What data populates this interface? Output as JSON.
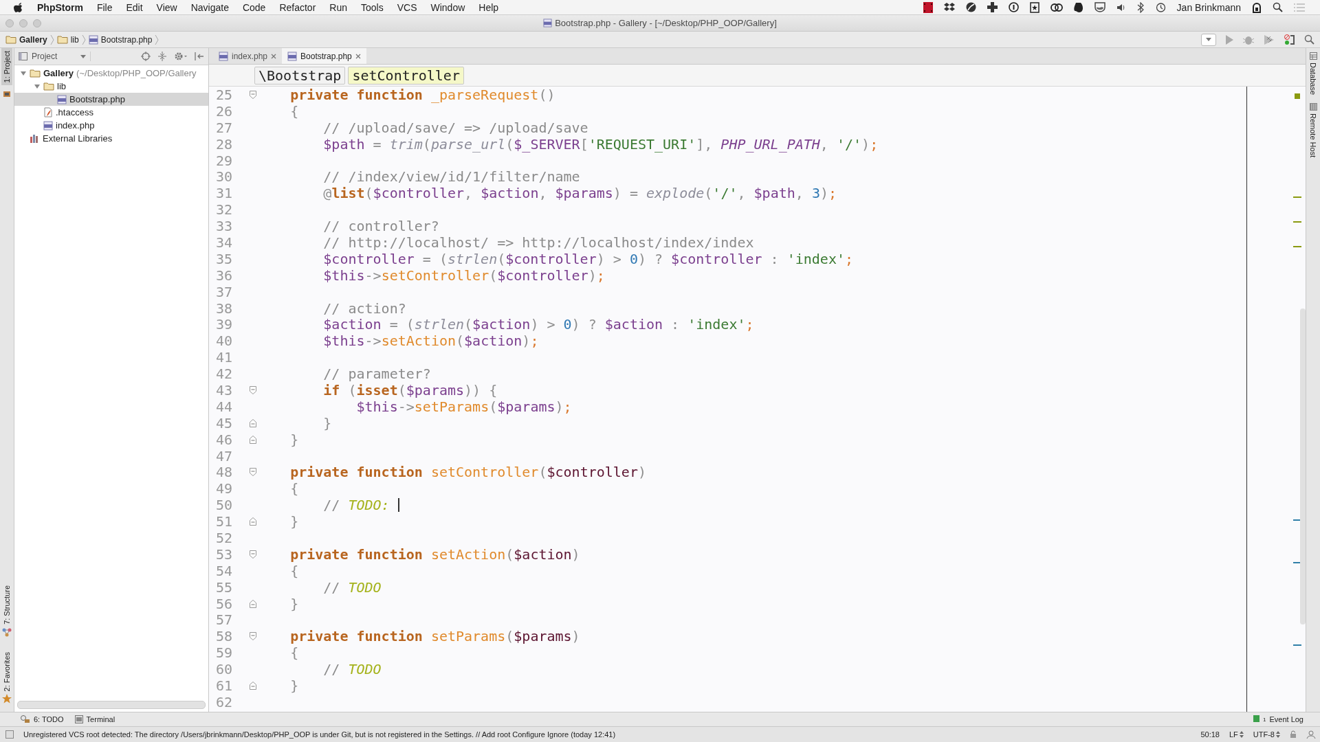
{
  "menu_bar": {
    "app": "PhpStorm",
    "items": [
      "File",
      "Edit",
      "View",
      "Navigate",
      "Code",
      "Refactor",
      "Run",
      "Tools",
      "VCS",
      "Window",
      "Help"
    ],
    "user": "Jan Brinkmann"
  },
  "window": {
    "title": "Bootstrap.php - Gallery - [~/Desktop/PHP_OOP/Gallery]"
  },
  "nav_bar": {
    "breadcrumbs": [
      {
        "label": "Gallery",
        "kind": "folder"
      },
      {
        "label": "lib",
        "kind": "folder"
      },
      {
        "label": "Bootstrap.php",
        "kind": "php"
      }
    ]
  },
  "left_stripe": {
    "top": [
      {
        "label": "1: Project",
        "selected": true
      }
    ],
    "bottom": [
      {
        "label": "7: Structure",
        "kind": "structure"
      },
      {
        "label": "2: Favorites",
        "kind": "favorites"
      }
    ]
  },
  "project_panel": {
    "title": "Project",
    "tree": [
      {
        "label": "Gallery",
        "hint": "(~/Desktop/PHP_OOP/Gallery",
        "kind": "folder",
        "bold": true,
        "expanded": true,
        "selected": false,
        "children": [
          {
            "label": "lib",
            "kind": "folder",
            "bold": false,
            "expanded": true,
            "selected": false,
            "children": [
              {
                "label": "Bootstrap.php",
                "kind": "php",
                "bold": false,
                "selected": true
              }
            ]
          },
          {
            "label": ".htaccess",
            "kind": "htaccess",
            "bold": false,
            "selected": false
          },
          {
            "label": "index.php",
            "kind": "php",
            "bold": false,
            "selected": false
          }
        ]
      },
      {
        "label": "External Libraries",
        "kind": "library",
        "bold": false,
        "selected": false
      }
    ]
  },
  "tabs": [
    {
      "label": "index.php",
      "selected": false
    },
    {
      "label": "Bootstrap.php",
      "selected": true
    }
  ],
  "scope_path": [
    {
      "label": "\\Bootstrap",
      "selected": false
    },
    {
      "label": "setController",
      "selected": true
    }
  ],
  "editor": {
    "lines": [
      {
        "number": "25",
        "kind": "fold_start",
        "tokens": [
          {
            "kind": "kw",
            "text": "    private function "
          },
          {
            "kind": "fn",
            "text": "_parseRequest"
          },
          {
            "kind": "punct",
            "text": "()"
          }
        ]
      },
      {
        "number": "26",
        "tokens": [
          {
            "kind": "punct",
            "text": "    {"
          }
        ]
      },
      {
        "number": "27",
        "tokens": [
          {
            "kind": "comment",
            "text": "        // /upload/save/ => /upload/save"
          }
        ]
      },
      {
        "number": "28",
        "tokens": [
          {
            "kind": "var",
            "text": "        $path"
          },
          {
            "kind": "punct",
            "text": " = "
          },
          {
            "kind": "builtin",
            "text": "trim"
          },
          {
            "kind": "punct",
            "text": "("
          },
          {
            "kind": "builtin",
            "text": "parse_url"
          },
          {
            "kind": "punct",
            "text": "("
          },
          {
            "kind": "var",
            "text": "$_SERVER"
          },
          {
            "kind": "punct",
            "text": "["
          },
          {
            "kind": "str",
            "text": "'REQUEST_URI'"
          },
          {
            "kind": "punct",
            "text": "], "
          },
          {
            "kind": "const",
            "text": "PHP_URL_PATH"
          },
          {
            "kind": "punct",
            "text": ", "
          },
          {
            "kind": "str",
            "text": "'/'"
          },
          {
            "kind": "punct",
            "text": ")"
          },
          {
            "kind": "semi",
            "text": ";"
          }
        ]
      },
      {
        "number": "29"
      },
      {
        "number": "30",
        "tokens": [
          {
            "kind": "comment",
            "text": "        // /index/view/id/1/filter/name"
          }
        ]
      },
      {
        "number": "31",
        "tokens": [
          {
            "kind": "punct",
            "text": "        @"
          },
          {
            "kind": "kw",
            "text": "list"
          },
          {
            "kind": "punct",
            "text": "("
          },
          {
            "kind": "var",
            "text": "$controller"
          },
          {
            "kind": "punct",
            "text": ", "
          },
          {
            "kind": "var",
            "text": "$action"
          },
          {
            "kind": "punct",
            "text": ", "
          },
          {
            "kind": "var",
            "text": "$params"
          },
          {
            "kind": "punct",
            "text": ") = "
          },
          {
            "kind": "builtin",
            "text": "explode"
          },
          {
            "kind": "punct",
            "text": "("
          },
          {
            "kind": "str",
            "text": "'/'"
          },
          {
            "kind": "punct",
            "text": ", "
          },
          {
            "kind": "var",
            "text": "$path"
          },
          {
            "kind": "punct",
            "text": ", "
          },
          {
            "kind": "num",
            "text": "3"
          },
          {
            "kind": "punct",
            "text": ")"
          },
          {
            "kind": "semi",
            "text": ";"
          }
        ]
      },
      {
        "number": "32"
      },
      {
        "number": "33",
        "tokens": [
          {
            "kind": "comment",
            "text": "        // controller?"
          }
        ]
      },
      {
        "number": "34",
        "tokens": [
          {
            "kind": "comment",
            "text": "        // http://localhost/ => http://localhost/index/index"
          }
        ]
      },
      {
        "number": "35",
        "tokens": [
          {
            "kind": "var",
            "text": "        $controller"
          },
          {
            "kind": "punct",
            "text": " = ("
          },
          {
            "kind": "builtin",
            "text": "strlen"
          },
          {
            "kind": "punct",
            "text": "("
          },
          {
            "kind": "var",
            "text": "$controller"
          },
          {
            "kind": "punct",
            "text": ") > "
          },
          {
            "kind": "num",
            "text": "0"
          },
          {
            "kind": "punct",
            "text": ") ? "
          },
          {
            "kind": "var",
            "text": "$controller"
          },
          {
            "kind": "punct",
            "text": " : "
          },
          {
            "kind": "str",
            "text": "'index'"
          },
          {
            "kind": "semi",
            "text": ";"
          }
        ]
      },
      {
        "number": "36",
        "tokens": [
          {
            "kind": "var",
            "text": "        $this"
          },
          {
            "kind": "punct",
            "text": "->"
          },
          {
            "kind": "fn",
            "text": "setController"
          },
          {
            "kind": "punct",
            "text": "("
          },
          {
            "kind": "var",
            "text": "$controller"
          },
          {
            "kind": "punct",
            "text": ")"
          },
          {
            "kind": "semi",
            "text": ";"
          }
        ]
      },
      {
        "number": "37"
      },
      {
        "number": "38",
        "tokens": [
          {
            "kind": "comment",
            "text": "        // action?"
          }
        ]
      },
      {
        "number": "39",
        "tokens": [
          {
            "kind": "var",
            "text": "        $action"
          },
          {
            "kind": "punct",
            "text": " = ("
          },
          {
            "kind": "builtin",
            "text": "strlen"
          },
          {
            "kind": "punct",
            "text": "("
          },
          {
            "kind": "var",
            "text": "$action"
          },
          {
            "kind": "punct",
            "text": ") > "
          },
          {
            "kind": "num",
            "text": "0"
          },
          {
            "kind": "punct",
            "text": ") ? "
          },
          {
            "kind": "var",
            "text": "$action"
          },
          {
            "kind": "punct",
            "text": " : "
          },
          {
            "kind": "str",
            "text": "'index'"
          },
          {
            "kind": "semi",
            "text": ";"
          }
        ]
      },
      {
        "number": "40",
        "tokens": [
          {
            "kind": "var",
            "text": "        $this"
          },
          {
            "kind": "punct",
            "text": "->"
          },
          {
            "kind": "fn",
            "text": "setAction"
          },
          {
            "kind": "punct",
            "text": "("
          },
          {
            "kind": "var",
            "text": "$action"
          },
          {
            "kind": "punct",
            "text": ")"
          },
          {
            "kind": "semi",
            "text": ";"
          }
        ]
      },
      {
        "number": "41"
      },
      {
        "number": "42",
        "tokens": [
          {
            "kind": "comment",
            "text": "        // parameter?"
          }
        ]
      },
      {
        "number": "43",
        "kind": "fold_start",
        "tokens": [
          {
            "kind": "kw",
            "text": "        if "
          },
          {
            "kind": "punct",
            "text": "("
          },
          {
            "kind": "kw",
            "text": "isset"
          },
          {
            "kind": "punct",
            "text": "("
          },
          {
            "kind": "var",
            "text": "$params"
          },
          {
            "kind": "punct",
            "text": ")) {"
          }
        ]
      },
      {
        "number": "44",
        "tokens": [
          {
            "kind": "var",
            "text": "            $this"
          },
          {
            "kind": "punct",
            "text": "->"
          },
          {
            "kind": "fn",
            "text": "setParams"
          },
          {
            "kind": "punct",
            "text": "("
          },
          {
            "kind": "var",
            "text": "$params"
          },
          {
            "kind": "punct",
            "text": ")"
          },
          {
            "kind": "semi",
            "text": ";"
          }
        ]
      },
      {
        "number": "45",
        "kind": "fold_end",
        "tokens": [
          {
            "kind": "punct",
            "text": "        }"
          }
        ]
      },
      {
        "number": "46",
        "kind": "fold_end",
        "tokens": [
          {
            "kind": "punct",
            "text": "    }"
          }
        ]
      },
      {
        "number": "47"
      },
      {
        "number": "48",
        "kind": "fold_start",
        "tokens": [
          {
            "kind": "kw",
            "text": "    private function "
          },
          {
            "kind": "fn",
            "text": "setController"
          },
          {
            "kind": "punct",
            "text": "("
          },
          {
            "kind": "param",
            "text": "$controller"
          },
          {
            "kind": "punct",
            "text": ")"
          }
        ]
      },
      {
        "number": "49",
        "tokens": [
          {
            "kind": "punct",
            "text": "    {"
          }
        ]
      },
      {
        "number": "50",
        "caret": true,
        "tokens": [
          {
            "kind": "comment",
            "text": "        // "
          },
          {
            "kind": "todo",
            "text": "TODO:"
          }
        ]
      },
      {
        "number": "51",
        "kind": "fold_end",
        "tokens": [
          {
            "kind": "punct",
            "text": "    }"
          }
        ]
      },
      {
        "number": "52"
      },
      {
        "number": "53",
        "kind": "fold_start",
        "tokens": [
          {
            "kind": "kw",
            "text": "    private function "
          },
          {
            "kind": "fn",
            "text": "setAction"
          },
          {
            "kind": "punct",
            "text": "("
          },
          {
            "kind": "param",
            "text": "$action"
          },
          {
            "kind": "punct",
            "text": ")"
          }
        ]
      },
      {
        "number": "54",
        "tokens": [
          {
            "kind": "punct",
            "text": "    {"
          }
        ]
      },
      {
        "number": "55",
        "tokens": [
          {
            "kind": "comment",
            "text": "        // "
          },
          {
            "kind": "todo",
            "text": "TODO"
          }
        ]
      },
      {
        "number": "56",
        "kind": "fold_end",
        "tokens": [
          {
            "kind": "punct",
            "text": "    }"
          }
        ]
      },
      {
        "number": "57"
      },
      {
        "number": "58",
        "kind": "fold_start",
        "tokens": [
          {
            "kind": "kw",
            "text": "    private function "
          },
          {
            "kind": "fn",
            "text": "setParams"
          },
          {
            "kind": "punct",
            "text": "("
          },
          {
            "kind": "param",
            "text": "$params"
          },
          {
            "kind": "punct",
            "text": ")"
          }
        ]
      },
      {
        "number": "59",
        "tokens": [
          {
            "kind": "punct",
            "text": "    {"
          }
        ]
      },
      {
        "number": "60",
        "tokens": [
          {
            "kind": "comment",
            "text": "        // "
          },
          {
            "kind": "todo",
            "text": "TODO"
          }
        ]
      },
      {
        "number": "61",
        "kind": "fold_end",
        "tokens": [
          {
            "kind": "punct",
            "text": "    }"
          }
        ]
      },
      {
        "number": "62"
      }
    ]
  },
  "right_stripe": [
    {
      "label": "Database",
      "kind": "database"
    },
    {
      "label": "Remote Host",
      "kind": "remote"
    }
  ],
  "tool_buttons": [
    {
      "label": "6: TODO",
      "kind": "todo"
    },
    {
      "label": "Terminal",
      "kind": "terminal"
    }
  ],
  "event_log": {
    "label": "Event Log",
    "count": "1"
  },
  "status_bar": {
    "message": "Unregistered VCS root detected: The directory /Users/jbrinkmann/Desktop/PHP_OOP is under Git, but is not registered in the Settings. // Add root  Configure  Ignore (today 12:41)",
    "position": "50:18",
    "line_ending": "LF",
    "encoding": "UTF-8"
  }
}
